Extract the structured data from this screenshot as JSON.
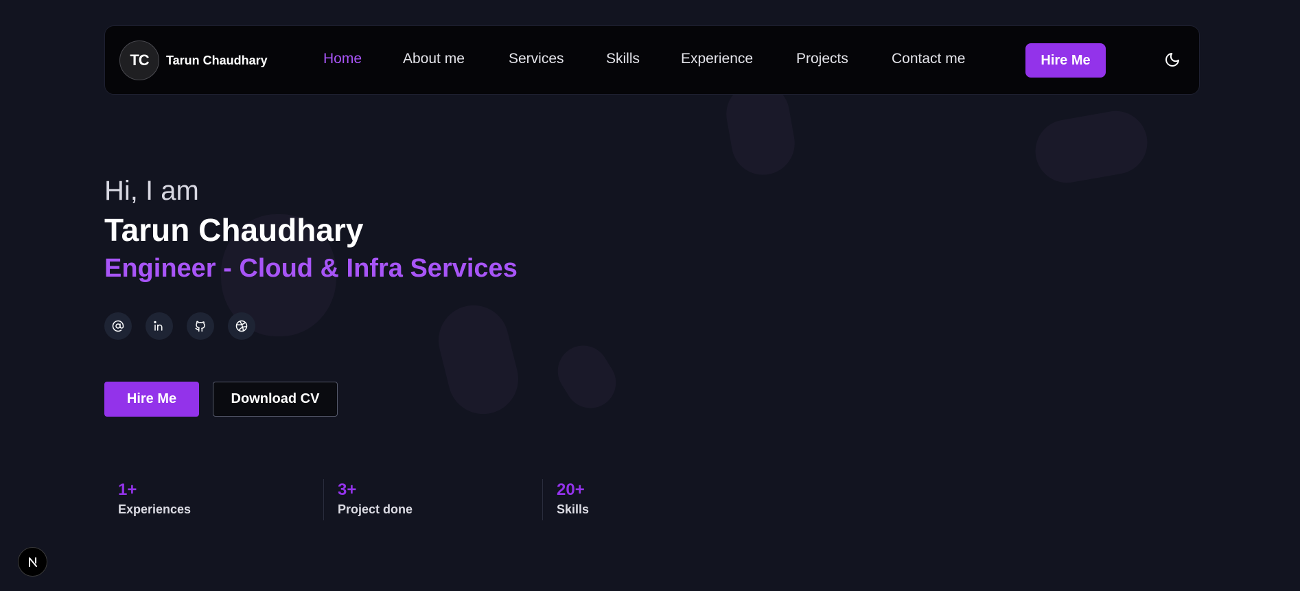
{
  "brand": {
    "initials": "TC",
    "name": "Tarun Chaudhary"
  },
  "nav": {
    "items": [
      {
        "label": "Home",
        "active": true
      },
      {
        "label": "About me",
        "active": false
      },
      {
        "label": "Services",
        "active": false
      },
      {
        "label": "Skills",
        "active": false
      },
      {
        "label": "Experience",
        "active": false
      },
      {
        "label": "Projects",
        "active": false
      },
      {
        "label": "Contact me",
        "active": false
      }
    ],
    "hire_label": "Hire Me",
    "theme_icon": "moon-icon"
  },
  "hero": {
    "greeting": "Hi, I am",
    "name": "Tarun Chaudhary",
    "role": "Engineer - Cloud & Infra Services",
    "socials": [
      {
        "icon": "at-sign-icon"
      },
      {
        "icon": "linkedin-icon"
      },
      {
        "icon": "github-icon"
      },
      {
        "icon": "dribbble-icon"
      }
    ],
    "hire_label": "Hire Me",
    "cv_label": "Download CV"
  },
  "stats": [
    {
      "value": "1+",
      "label": "Experiences"
    },
    {
      "value": "3+",
      "label": "Project done"
    },
    {
      "value": "20+",
      "label": "Skills"
    }
  ],
  "colors": {
    "accent": "#9333ea",
    "accent_text": "#a855f7",
    "background": "#121420",
    "navbar": "#050508"
  }
}
